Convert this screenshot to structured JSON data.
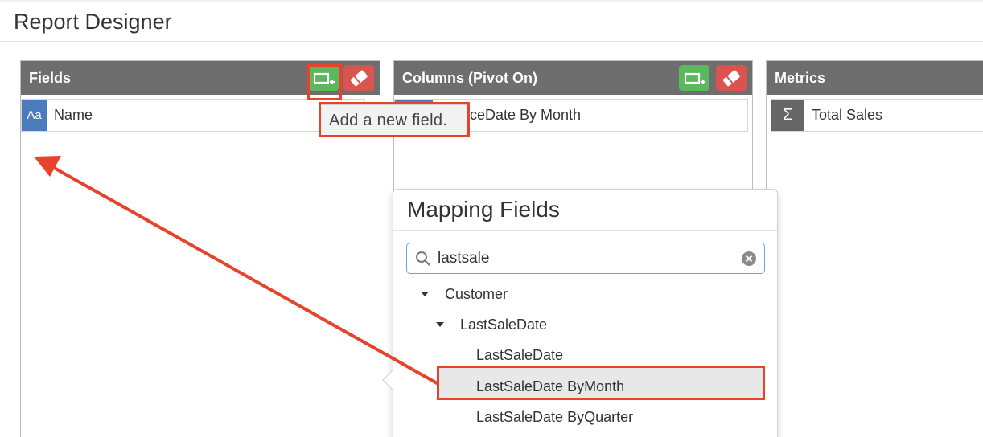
{
  "window": {
    "title": "Report Designer"
  },
  "panels": {
    "fields": {
      "title": "Fields",
      "items": [
        {
          "type_badge": "Aa",
          "label": "Name"
        }
      ],
      "add_button_icon": "add-field-icon",
      "clear_button_icon": "eraser-icon"
    },
    "columns": {
      "title": "Columns (Pivot On)",
      "items": [
        {
          "type_badge": "",
          "label": "ceDate By Month"
        }
      ],
      "add_button_icon": "add-field-icon",
      "clear_button_icon": "eraser-icon"
    },
    "metrics": {
      "title": "Metrics",
      "items": [
        {
          "type_badge": "Σ",
          "label": "Total Sales"
        }
      ]
    }
  },
  "tooltip": {
    "text": "Add a new field."
  },
  "mapping_popover": {
    "title": "Mapping Fields",
    "search": {
      "value": "lastsale",
      "placeholder": ""
    },
    "tree": [
      {
        "label": "Customer",
        "level": 0,
        "expanded": true
      },
      {
        "label": "LastSaleDate",
        "level": 1,
        "expanded": true
      },
      {
        "label": "LastSaleDate",
        "level": 2
      },
      {
        "label": "LastSaleDate ByMonth",
        "level": 2,
        "selected": true
      },
      {
        "label": "LastSaleDate ByQuarter",
        "level": 2
      }
    ]
  },
  "colors": {
    "header_bg": "#6e6e6e",
    "add_green": "#5cb85c",
    "clear_red": "#d9534f",
    "badge_blue": "#4a7bbd",
    "annotation_red": "#e5432a",
    "search_border": "#6fa1d9"
  }
}
